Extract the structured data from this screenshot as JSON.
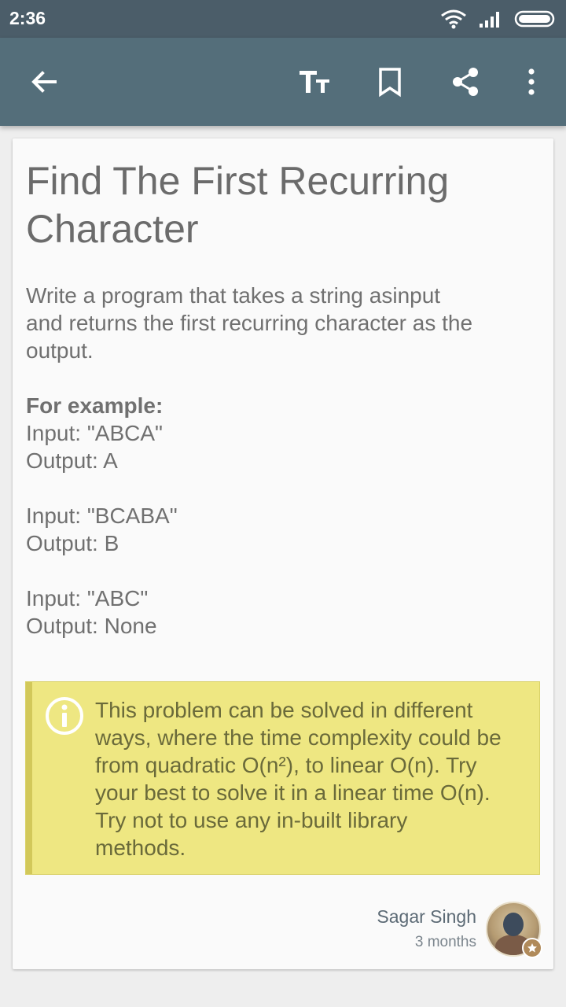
{
  "status_bar": {
    "time": "2:36"
  },
  "toolbar": {
    "back_icon": "arrow-back-icon",
    "text_size_icon": "text-size-icon",
    "bookmark_icon": "bookmark-icon",
    "share_icon": "share-icon",
    "more_icon": "more-vert-icon"
  },
  "article": {
    "title": "Find The First Recurring Character",
    "intro_lines": [
      "Write a program that takes a string asinput",
      "and returns the first recurring character as the",
      "output."
    ],
    "example_heading": "For example:",
    "examples": [
      {
        "input": "Input: \"ABCA\"",
        "output": "Output: A"
      },
      {
        "input": "Input: \"BCABA\"",
        "output": "Output: B"
      },
      {
        "input": "Input: \"ABC\"",
        "output": "Output: None"
      }
    ],
    "note": {
      "icon": "info-icon",
      "lines": [
        "This problem can be solved in different",
        "ways, where the time complexity could be",
        "from quadratic O(n²), to linear O(n). Try",
        "your best to solve it in a linear time O(n).",
        "Try not to use any in-built library",
        "methods."
      ]
    },
    "author": {
      "name": "Sagar Singh",
      "time": "3 months"
    }
  },
  "colors": {
    "status_bar": "#4b5d69",
    "app_bar": "#546e7a",
    "note_background": "#eee782",
    "note_border": "#d2c85a"
  }
}
